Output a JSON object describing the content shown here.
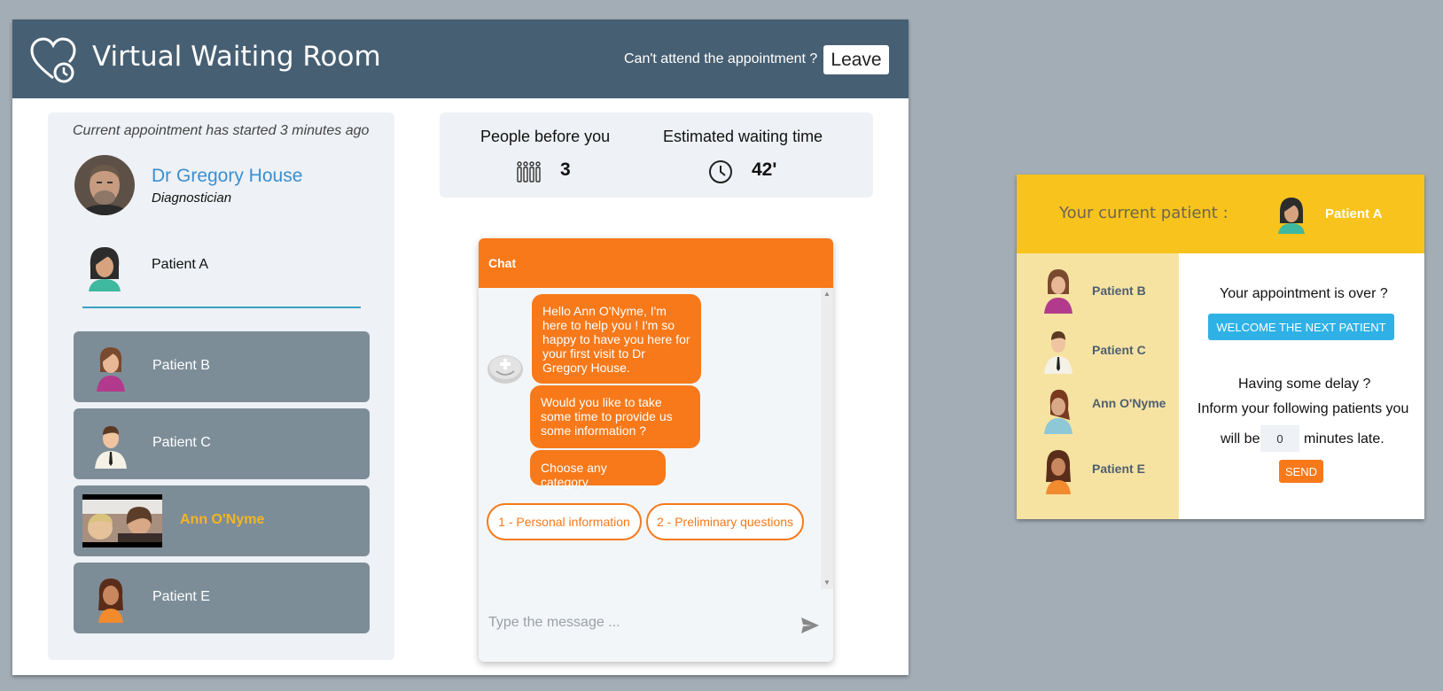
{
  "app": {
    "title": "Virtual Waiting Room"
  },
  "header": {
    "leave_question": "Can't attend the appointment ?",
    "leave_button": "Leave"
  },
  "appointment": {
    "status": "Current appointment has started 3 minutes ago"
  },
  "doctor": {
    "name": "Dr Gregory House",
    "role": "Diagnostician"
  },
  "current_patient": {
    "name": "Patient A"
  },
  "queue": [
    {
      "name": "Patient B",
      "icon": "female-avatar-icon"
    },
    {
      "name": "Patient C",
      "icon": "male-avatar-icon"
    },
    {
      "name": "Ann O'Nyme",
      "icon": "video-thumbnail",
      "is_me": true
    },
    {
      "name": "Patient E",
      "icon": "female-avatar-icon"
    }
  ],
  "stats": {
    "people_label": "People before you",
    "people_value": "3",
    "wait_label": "Estimated waiting time",
    "wait_value": "42'"
  },
  "chat": {
    "title": "Chat",
    "messages": [
      "Hello Ann O'Nyme, I'm here to help you ! I'm so happy to have you here for your first visit to Dr Gregory House.",
      "Would you like to take some time to provide us some information ?",
      "Choose any category"
    ],
    "quick_replies": [
      "1 - Personal information",
      "2 - Preliminary questions"
    ],
    "input_placeholder": "Type the message ..."
  },
  "doctor_view": {
    "current_label": "Your current patient :",
    "current_patient": "Patient A",
    "queue": [
      "Patient B",
      "Patient C",
      "Ann O'Nyme",
      "Patient E"
    ],
    "over_question": "Your appointment is over ?",
    "welcome_button": "WELCOME THE NEXT PATIENT",
    "delay_question": "Having some delay ?",
    "inform_text": "Inform your following patients you",
    "will_be": "will be",
    "minutes_value": "0",
    "minutes_late": "minutes late.",
    "send_button": "SEND"
  },
  "colors": {
    "header": "#475f72",
    "accent_orange": "#f7791a",
    "doctor_blue": "#3a8fd2",
    "yellow": "#f8c31c",
    "welcome_blue": "#2fb1e6"
  }
}
